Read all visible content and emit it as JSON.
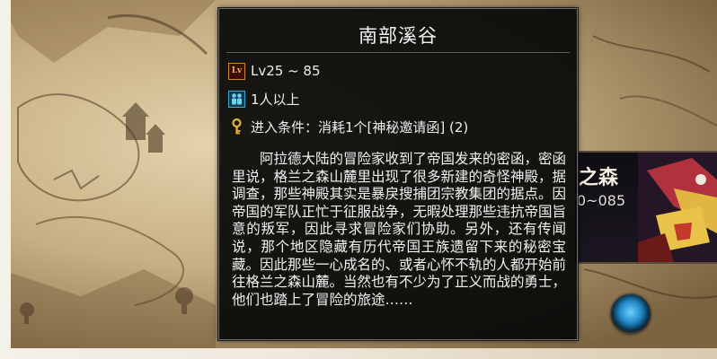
{
  "tooltip": {
    "title": "南部溪谷",
    "level_text": "Lv25 ~ 85",
    "party_text": "1人以上",
    "condition_text": "进入条件：消耗1个[神秘邀请函] (2)",
    "description": "阿拉德大陆的冒险家收到了帝国发来的密函，密函里说，格兰之森山麓里出现了很多新建的奇怪神殿，据调查，那些神殿其实是暴戾搜捕团宗教集团的据点。因帝国的军队正忙于征服战争，无暇处理那些违抗帝国旨意的叛军，因此寻求冒险家们协助。另外，还有传闻说，那个地区隐藏有历代帝国王族遗留下来的秘密宝藏。因此那些一心成名的、或者心怀不轨的人都开始前往格兰之森山麓。当然也有不少为了正义而战的勇士，他们也踏上了冒险的旅途……",
    "icons": {
      "level": "level-badge-icon",
      "party": "party-members-icon",
      "condition": "key-icon"
    },
    "level_badge_text": "Lv"
  },
  "map_node": {
    "title": "之森",
    "level_range": "0~085"
  },
  "colors": {
    "tooltip_bg": "#080808",
    "tooltip_border": "#6f6f6f",
    "text": "#f2f2f2",
    "level_icon": "#c9892c",
    "party_icon": "#3fa8d2",
    "map_button": "#1f86c4"
  }
}
